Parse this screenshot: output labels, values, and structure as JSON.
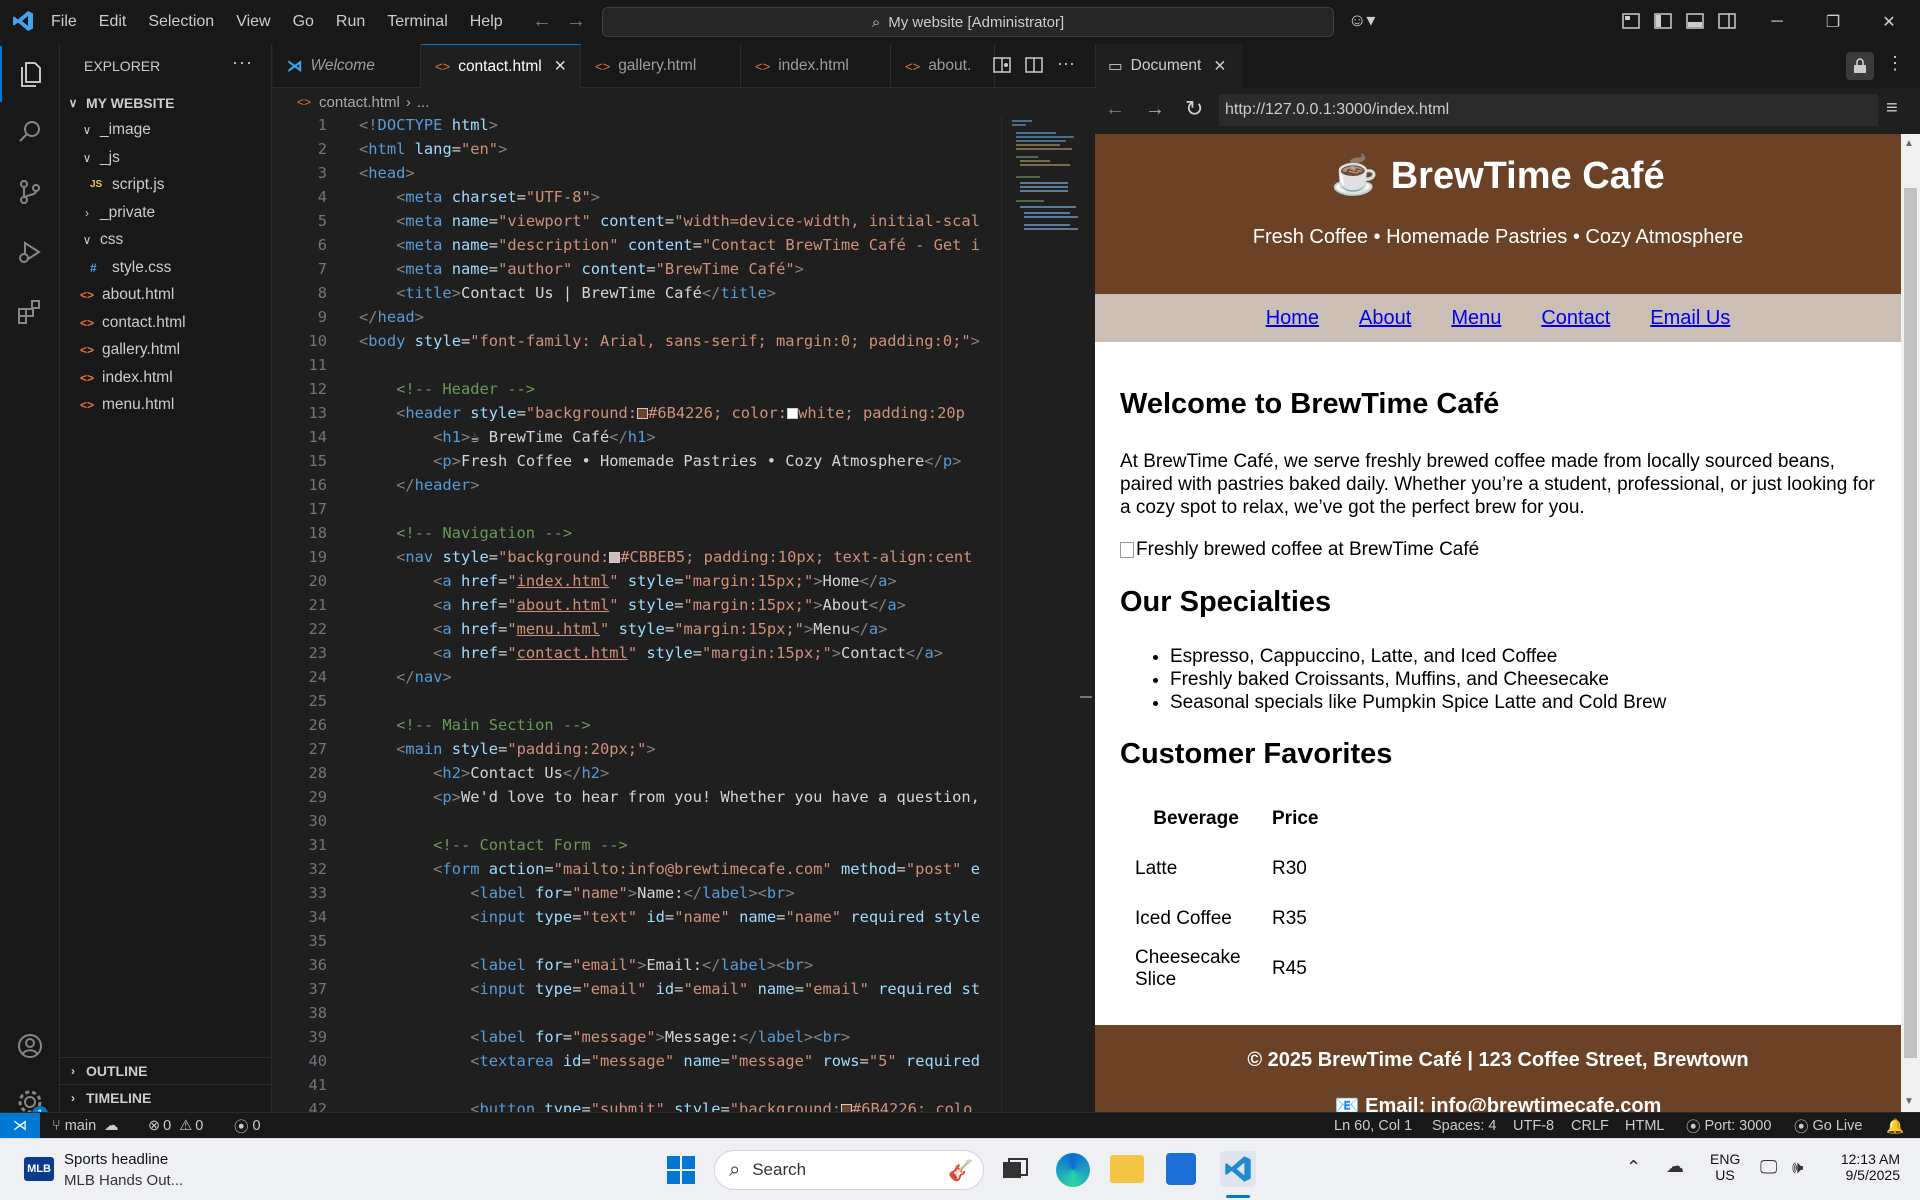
{
  "titlebar": {
    "menu": [
      "File",
      "Edit",
      "Selection",
      "View",
      "Go",
      "Run",
      "Terminal",
      "Help"
    ],
    "command_center": "My website [Administrator]"
  },
  "sidebar": {
    "title": "EXPLORER",
    "root": "MY WEBSITE",
    "items": [
      {
        "label": "_image",
        "kind": "folder-open"
      },
      {
        "label": "_js",
        "kind": "folder-open"
      },
      {
        "label": "script.js",
        "kind": "js"
      },
      {
        "label": "_private",
        "kind": "folder"
      },
      {
        "label": "css",
        "kind": "folder-open"
      },
      {
        "label": "style.css",
        "kind": "css"
      },
      {
        "label": "about.html",
        "kind": "html"
      },
      {
        "label": "contact.html",
        "kind": "html"
      },
      {
        "label": "gallery.html",
        "kind": "html"
      },
      {
        "label": "index.html",
        "kind": "html"
      },
      {
        "label": "menu.html",
        "kind": "html"
      }
    ],
    "outline": "OUTLINE",
    "timeline": "TIMELINE",
    "settings_badge": "1"
  },
  "editor": {
    "tabs": [
      {
        "label": "Welcome",
        "icon": "vscode-icon"
      },
      {
        "label": "contact.html",
        "icon": "html-icon",
        "active": true
      },
      {
        "label": "gallery.html",
        "icon": "html-icon"
      },
      {
        "label": "index.html",
        "icon": "html-icon"
      },
      {
        "label": "about.",
        "icon": "html-icon"
      }
    ],
    "breadcrumb": [
      "contact.html",
      "..."
    ],
    "color_swatches": [
      "#6B4226",
      "#ffffff",
      "#CBBEB5"
    ]
  },
  "preview": {
    "tab_label": "Document",
    "url": "http://127.0.0.1:3000/index.html",
    "header_title": "BrewTime Café",
    "header_subtitle": "Fresh Coffee • Homemade Pastries • Cozy Atmosphere",
    "nav": [
      "Home",
      "About",
      "Menu",
      "Contact",
      "Email Us"
    ],
    "welcome_heading": "Welcome to BrewTime Café",
    "welcome_text": "At BrewTime Café, we serve freshly brewed coffee made from locally sourced beans, paired with pastries baked daily. Whether you’re a student, professional, or just looking for a cozy spot to relax, we’ve got the perfect brew for you.",
    "image_alt": "Freshly brewed coffee at BrewTime Café",
    "specialties_heading": "Our Specialties",
    "specialties": [
      "Espresso, Cappuccino, Latte, and Iced Coffee",
      "Freshly baked Croissants, Muffins, and Cheesecake",
      "Seasonal specials like Pumpkin Spice Latte and Cold Brew"
    ],
    "favorites_heading": "Customer Favorites",
    "table_headers": [
      "Beverage",
      "Price"
    ],
    "table_rows": [
      [
        "Latte",
        "R30"
      ],
      [
        "Iced Coffee",
        "R35"
      ],
      [
        "Cheesecake Slice",
        "R45"
      ]
    ],
    "footer_line1": "© 2025 BrewTime Café | 123 Coffee Street, Brewtown",
    "footer_line2": "📧 Email: info@brewtimecafe.com",
    "brand_color": "#6B4226",
    "nav_color": "#CBBEB5"
  },
  "statusbar": {
    "branch": "main",
    "errors": "0",
    "warnings": "0",
    "ports": "0",
    "position": "Ln 60, Col 1",
    "spaces": "Spaces: 4",
    "encoding": "UTF-8",
    "eol": "CRLF",
    "language": "HTML",
    "port": "Port: 3000",
    "golive": "Go Live"
  },
  "taskbar": {
    "news_title": "Sports headline",
    "news_sub": "MLB Hands Out...",
    "search": "Search",
    "lang1": "ENG",
    "lang2": "US",
    "time": "12:13 AM",
    "date": "9/5/2025"
  }
}
